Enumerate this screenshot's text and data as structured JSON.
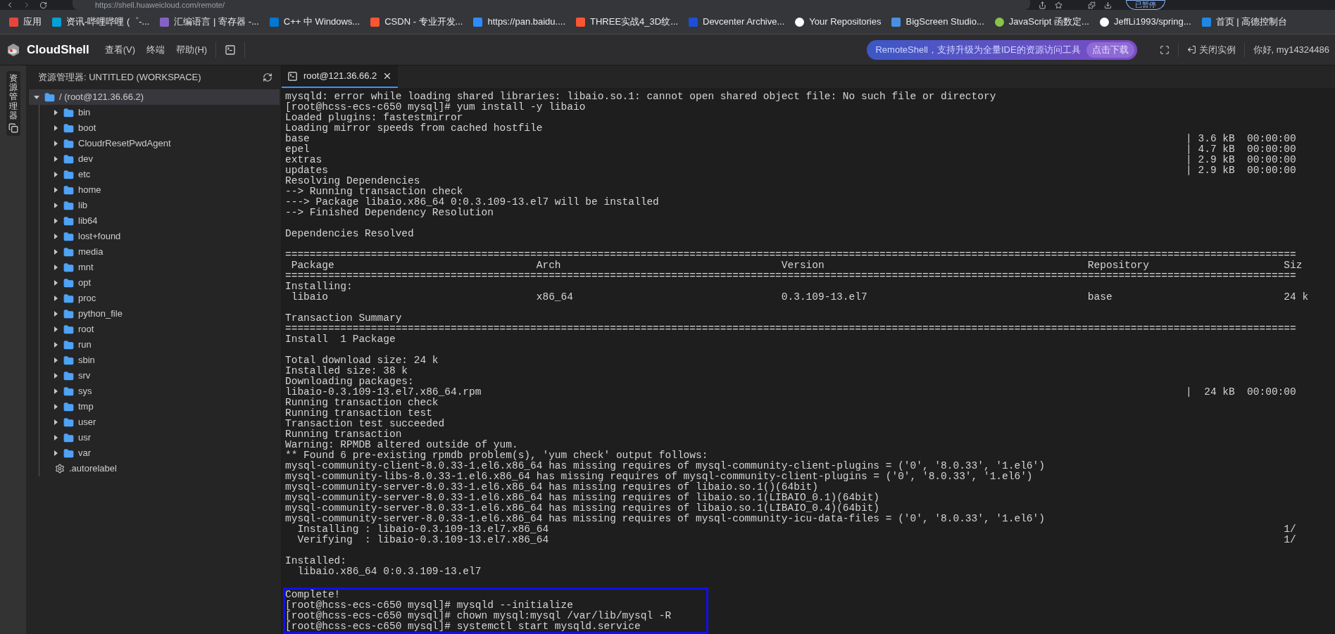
{
  "browser": {
    "url": "https://shell.huaweicloud.com/remote/",
    "profile": "已暂停",
    "bookmarks": [
      "应用",
      "资讯-哔哩哔哩 (゜-...",
      "汇编语言 | 寄存器 -...",
      "C++ 中 Windows...",
      "CSDN - 专业开发...",
      "https://pan.baidu....",
      "THREE实战4_3D纹...",
      "Devcenter Archive...",
      "Your Repositories",
      "BigScreen Studio...",
      "JavaScript 函数定...",
      "JeffLi1993/spring...",
      "首页 | 高德控制台"
    ]
  },
  "header": {
    "title": "CloudShell",
    "menu": [
      "查看(V)",
      "终端",
      "帮助(H)"
    ],
    "banner": {
      "text": "RemoteShell，支持升级为全量IDE的资源访问工具",
      "button": "点击下载"
    },
    "close_instance": "关闭实例",
    "greeting": "你好, my14324486"
  },
  "activity_bar": {
    "label": "资源管理器"
  },
  "explorer": {
    "title": "资源管理器: UNTITLED (WORKSPACE)",
    "tree": [
      {
        "label": "/ (root@121.36.66.2)",
        "kind": "folder",
        "expanded": true,
        "selected": true,
        "children": [
          {
            "label": "bin",
            "kind": "folder",
            "expanded": false,
            "selected": false
          },
          {
            "label": "boot",
            "kind": "folder",
            "expanded": false,
            "selected": false
          },
          {
            "label": "CloudrResetPwdAgent",
            "kind": "folder",
            "expanded": false,
            "selected": false
          },
          {
            "label": "dev",
            "kind": "folder",
            "expanded": false,
            "selected": false
          },
          {
            "label": "etc",
            "kind": "folder",
            "expanded": false,
            "selected": false
          },
          {
            "label": "home",
            "kind": "folder",
            "expanded": false,
            "selected": false
          },
          {
            "label": "lib",
            "kind": "folder",
            "expanded": false,
            "selected": false
          },
          {
            "label": "lib64",
            "kind": "folder",
            "expanded": false,
            "selected": false
          },
          {
            "label": "lost+found",
            "kind": "folder",
            "expanded": false,
            "selected": false
          },
          {
            "label": "media",
            "kind": "folder",
            "expanded": false,
            "selected": false
          },
          {
            "label": "mnt",
            "kind": "folder",
            "expanded": false,
            "selected": false
          },
          {
            "label": "opt",
            "kind": "folder",
            "expanded": false,
            "selected": false
          },
          {
            "label": "proc",
            "kind": "folder",
            "expanded": false,
            "selected": false
          },
          {
            "label": "python_file",
            "kind": "folder",
            "expanded": false,
            "selected": false
          },
          {
            "label": "root",
            "kind": "folder",
            "expanded": false,
            "selected": false
          },
          {
            "label": "run",
            "kind": "folder",
            "expanded": false,
            "selected": false
          },
          {
            "label": "sbin",
            "kind": "folder",
            "expanded": false,
            "selected": false
          },
          {
            "label": "srv",
            "kind": "folder",
            "expanded": false,
            "selected": false
          },
          {
            "label": "sys",
            "kind": "folder",
            "expanded": false,
            "selected": false
          },
          {
            "label": "tmp",
            "kind": "folder",
            "expanded": false,
            "selected": false
          },
          {
            "label": "user",
            "kind": "folder",
            "expanded": false,
            "selected": false
          },
          {
            "label": "usr",
            "kind": "folder",
            "expanded": false,
            "selected": false
          },
          {
            "label": "var",
            "kind": "folder",
            "expanded": false,
            "selected": false
          },
          {
            "label": ".autorelabel",
            "kind": "file",
            "selected": false
          }
        ]
      }
    ]
  },
  "tabs": [
    {
      "label": "root@121.36.66.2",
      "selected": true
    }
  ],
  "terminal": {
    "lines": [
      {
        "kind": "text",
        "text": "mysqld: error while loading shared libraries: libaio.so.1: cannot open shared object file: No such file or directory"
      },
      {
        "kind": "text",
        "text": "[root@hcss-ecs-c650 mysql]# yum install -y libaio"
      },
      {
        "kind": "text",
        "text": "Loaded plugins: fastestmirror"
      },
      {
        "kind": "text",
        "text": "Loading mirror speeds from cached hostfile"
      },
      {
        "kind": "cols",
        "text": "base",
        "right": "| 3.6 kB  00:00:00"
      },
      {
        "kind": "cols",
        "text": "epel",
        "right": "| 4.7 kB  00:00:00"
      },
      {
        "kind": "cols",
        "text": "extras",
        "right": "| 2.9 kB  00:00:00"
      },
      {
        "kind": "cols",
        "text": "updates",
        "right": "| 2.9 kB  00:00:00"
      },
      {
        "kind": "text",
        "text": "Resolving Dependencies"
      },
      {
        "kind": "text",
        "text": "--> Running transaction check"
      },
      {
        "kind": "text",
        "text": "---> Package libaio.x86_64 0:0.3.109-13.el7 will be installed"
      },
      {
        "kind": "text",
        "text": "--> Finished Dependency Resolution"
      },
      {
        "kind": "blank"
      },
      {
        "kind": "text",
        "text": "Dependencies Resolved"
      },
      {
        "kind": "blank"
      },
      {
        "kind": "rule",
        "text": "====================================================================================================================================================================="
      },
      {
        "kind": "table",
        "cells": [
          " Package",
          "Arch",
          "Version",
          "Repository",
          "Siz"
        ]
      },
      {
        "kind": "rule",
        "text": "====================================================================================================================================================================="
      },
      {
        "kind": "text",
        "text": "Installing:"
      },
      {
        "kind": "table",
        "cells": [
          " libaio",
          "x86_64",
          "0.3.109-13.el7",
          "base",
          "24 k"
        ]
      },
      {
        "kind": "blank"
      },
      {
        "kind": "text",
        "text": "Transaction Summary"
      },
      {
        "kind": "rule",
        "text": "====================================================================================================================================================================="
      },
      {
        "kind": "text",
        "text": "Install  1 Package"
      },
      {
        "kind": "blank"
      },
      {
        "kind": "text",
        "text": "Total download size: 24 k"
      },
      {
        "kind": "text",
        "text": "Installed size: 38 k"
      },
      {
        "kind": "text",
        "text": "Downloading packages:"
      },
      {
        "kind": "cols",
        "text": "libaio-0.3.109-13.el7.x86_64.rpm",
        "right": "|  24 kB  00:00:00"
      },
      {
        "kind": "text",
        "text": "Running transaction check"
      },
      {
        "kind": "text",
        "text": "Running transaction test"
      },
      {
        "kind": "text",
        "text": "Transaction test succeeded"
      },
      {
        "kind": "text",
        "text": "Running transaction"
      },
      {
        "kind": "text",
        "text": "Warning: RPMDB altered outside of yum."
      },
      {
        "kind": "text",
        "text": "** Found 6 pre-existing rpmdb problem(s), 'yum check' output follows:"
      },
      {
        "kind": "text",
        "text": "mysql-community-client-8.0.33-1.el6.x86_64 has missing requires of mysql-community-client-plugins = ('0', '8.0.33', '1.el6')"
      },
      {
        "kind": "text",
        "text": "mysql-community-libs-8.0.33-1.el6.x86_64 has missing requires of mysql-community-client-plugins = ('0', '8.0.33', '1.el6')"
      },
      {
        "kind": "text",
        "text": "mysql-community-server-8.0.33-1.el6.x86_64 has missing requires of libaio.so.1()(64bit)"
      },
      {
        "kind": "text",
        "text": "mysql-community-server-8.0.33-1.el6.x86_64 has missing requires of libaio.so.1(LIBAIO_0.1)(64bit)"
      },
      {
        "kind": "text",
        "text": "mysql-community-server-8.0.33-1.el6.x86_64 has missing requires of libaio.so.1(LIBAIO_0.4)(64bit)"
      },
      {
        "kind": "text",
        "text": "mysql-community-server-8.0.33-1.el6.x86_64 has missing requires of mysql-community-icu-data-files = ('0', '8.0.33', '1.el6')"
      },
      {
        "kind": "wide",
        "text": "  Installing : libaio-0.3.109-13.el7.x86_64",
        "right": "1/"
      },
      {
        "kind": "wide",
        "text": "  Verifying  : libaio-0.3.109-13.el7.x86_64",
        "right": "1/"
      },
      {
        "kind": "blank"
      },
      {
        "kind": "text",
        "text": "Installed:"
      },
      {
        "kind": "text",
        "text": "  libaio.x86_64 0:0.3.109-13.el7"
      },
      {
        "kind": "blank"
      }
    ],
    "highlight": {
      "lines": [
        {
          "kind": "text",
          "text": "Complete!"
        },
        {
          "kind": "text",
          "text": "[root@hcss-ecs-c650 mysql]# mysqld --initialize"
        },
        {
          "kind": "text",
          "text": "[root@hcss-ecs-c650 mysql]# chown mysql:mysql /var/lib/mysql -R"
        },
        {
          "kind": "text",
          "text": "[root@hcss-ecs-c650 mysql]# systemctl start mysqld.service"
        }
      ]
    }
  }
}
